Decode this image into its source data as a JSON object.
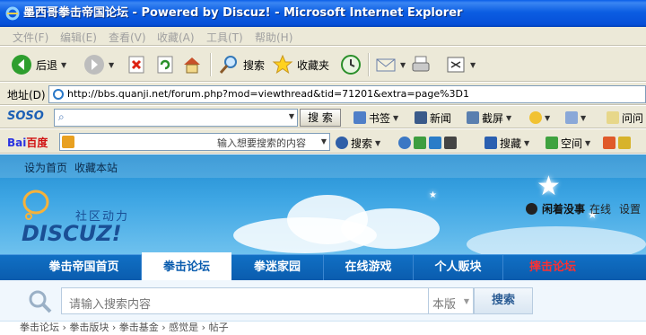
{
  "window": {
    "title": "墨西哥拳击帝国论坛 - Powered by Discuz! - Microsoft Internet Explorer"
  },
  "menu": [
    "文件(F)",
    "编辑(E)",
    "查看(V)",
    "收藏(A)",
    "工具(T)",
    "帮助(H)"
  ],
  "toolbar": {
    "back": "后退",
    "search": "搜索",
    "favorites": "收藏夹"
  },
  "address": {
    "label": "地址(D)",
    "url": "http://bbs.quanji.net/forum.php?mod=viewthread&tid=71201&extra=page%3D1"
  },
  "sogou": {
    "logo": "SOSO",
    "search_btn": "搜 索",
    "bookmarks": "书签",
    "news": "新闻",
    "screenshot": "截屏",
    "ask": "问问"
  },
  "baidu": {
    "logo": "百度",
    "placeholder": "输入想要搜索的内容",
    "search": "搜索",
    "collect": "搜藏",
    "space": "空间"
  },
  "site": {
    "top_links": [
      "设为首页",
      "收藏本站"
    ],
    "logo_text": "DISCUZ!",
    "logo_sub": "社区动力",
    "user": {
      "name": "闲着没事",
      "status": "在线",
      "settings": "设置"
    },
    "nav": [
      "拳击帝国首页",
      "拳击论坛",
      "拳迷家园",
      "在线游戏",
      "个人贩块",
      "摔击论坛"
    ],
    "search": {
      "placeholder": "请输入搜索内容",
      "scope": "本版",
      "button": "搜索"
    },
    "breadcrumb": "拳击论坛 › 拳击版块 › 拳击基金 › 感觉是 › 帖子"
  },
  "colors": {
    "titlebar": "#0A5EE8",
    "nav": "#0A5CAE",
    "nav_hot": "#E02020"
  }
}
